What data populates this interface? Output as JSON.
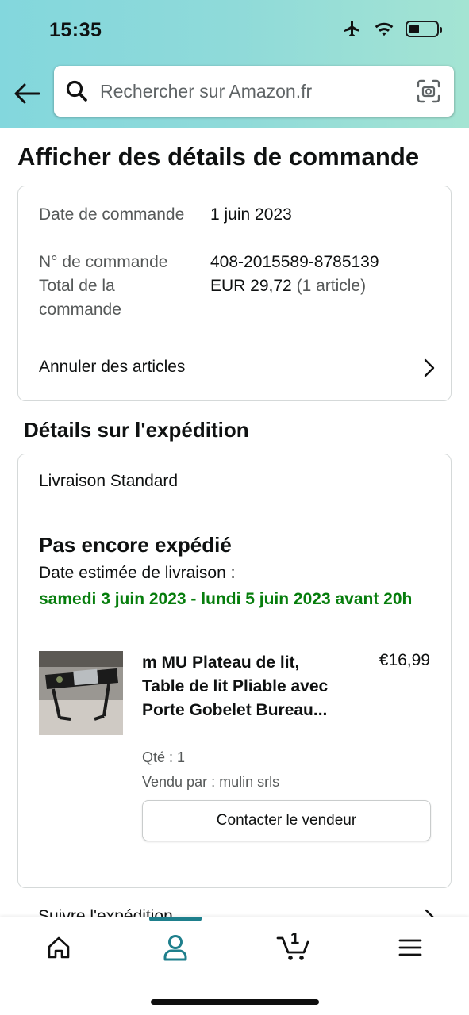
{
  "status_bar": {
    "time": "15:35"
  },
  "search": {
    "placeholder": "Rechercher sur Amazon.fr"
  },
  "page": {
    "title": "Afficher des détails de commande"
  },
  "order": {
    "date_label": "Date de commande",
    "date_value": "1 juin 2023",
    "number_label": "N° de commande",
    "number_value": "408-2015589-8785139",
    "total_label": "Total de la commande",
    "total_value": "EUR 29,72",
    "total_items": "(1 article)",
    "cancel_label": "Annuler des articles"
  },
  "shipping": {
    "section_title": "Détails sur l'expédition",
    "method": "Livraison Standard",
    "status": "Pas encore expédié",
    "eta_label": "Date estimée de livraison :",
    "eta_value": "samedi 3 juin 2023 - lundi 5 juin 2023 avant 20h",
    "track_label": "Suivre l'expédition"
  },
  "product": {
    "title": "m MU Plateau de lit, Table de lit Pliable avec Porte Gobelet Bureau...",
    "price": "€16,99",
    "qty": "Qté : 1",
    "seller": "Vendu par : mulin srls",
    "contact_label": "Contacter le vendeur"
  },
  "nav": {
    "cart_count": "1"
  },
  "colors": {
    "header_start": "#83d7dd",
    "header_end": "#a4e4d3",
    "eta_green": "#067d0c",
    "nav_active": "#1e7f8c"
  }
}
